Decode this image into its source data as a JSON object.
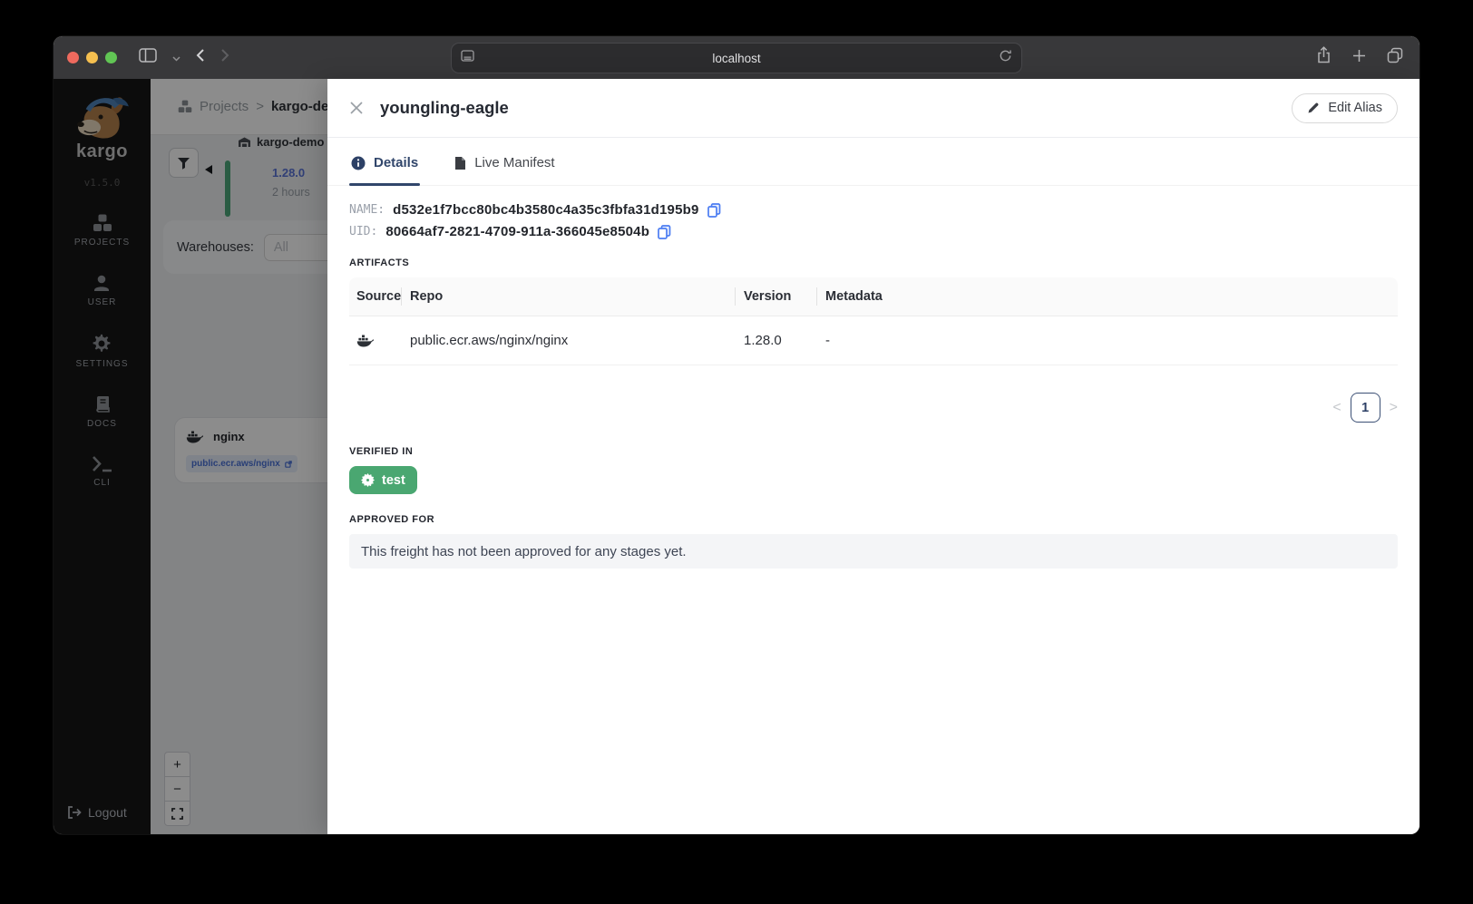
{
  "browser": {
    "url": "localhost"
  },
  "sidebar": {
    "logo_text": "kargo",
    "version": "v1.5.0",
    "items": [
      {
        "label": "PROJECTS"
      },
      {
        "label": "USER"
      },
      {
        "label": "SETTINGS"
      },
      {
        "label": "DOCS"
      },
      {
        "label": "CLI"
      }
    ],
    "logout_label": "Logout"
  },
  "pipeline": {
    "breadcrumb": {
      "root": "Projects",
      "separator": ">",
      "current": "kargo-demo"
    },
    "node": {
      "name": "kargo-demo",
      "version": "1.28.0",
      "age": "2 hours"
    },
    "warehouses_label": "Warehouses:",
    "warehouses_value": "All",
    "repo_card": {
      "name": "nginx",
      "link": "public.ecr.aws/nginx"
    },
    "zoom_controls": {
      "zoom_in": "+",
      "zoom_out": "−"
    }
  },
  "drawer": {
    "title": "youngling-eagle",
    "edit_alias_label": "Edit Alias",
    "tabs": [
      {
        "label": "Details"
      },
      {
        "label": "Live Manifest"
      }
    ],
    "fields": [
      {
        "label": "NAME:",
        "value": "d532e1f7bcc80bc4b3580c4a35c3fbfa31d195b9"
      },
      {
        "label": "UID:",
        "value": "80664af7-2821-4709-911a-366045e8504b"
      }
    ],
    "artifacts": {
      "heading": "ARTIFACTS",
      "columns": [
        "Source",
        "Repo",
        "Version",
        "Metadata"
      ],
      "rows": [
        {
          "source_icon": "docker-icon",
          "repo": "public.ecr.aws/nginx/nginx",
          "version": "1.28.0",
          "metadata": "-"
        }
      ],
      "pagination": {
        "prev": "<",
        "page": "1",
        "next": ">"
      }
    },
    "verified_in": {
      "heading": "VERIFIED IN",
      "stages": [
        {
          "name": "test"
        }
      ]
    },
    "approved_for": {
      "heading": "APPROVED FOR",
      "empty_message": "This freight has not been approved for any stages yet."
    }
  },
  "colors": {
    "accent_navy": "#31466b",
    "copy_blue": "#4c7df2",
    "stage_green": "#4aa771",
    "version_blue": "#5a74d8"
  }
}
